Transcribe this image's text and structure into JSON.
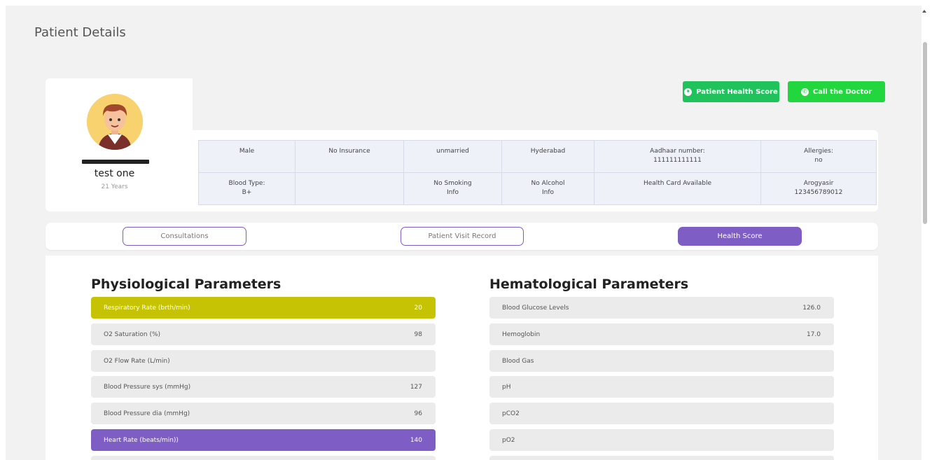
{
  "page": {
    "title": "Patient Details"
  },
  "patient": {
    "name": "test one",
    "age": "21 Years"
  },
  "actions": {
    "health_score_label": "Patient Health Score",
    "call_doctor_label": "Call the Doctor"
  },
  "info": {
    "gender": "Male",
    "insurance": "No Insurance",
    "marital": "unmarried",
    "city": "Hyderabad",
    "aadhaar_label": "Aadhaar number:",
    "aadhaar_value": "111111111111",
    "allergies_label": "Allergies:",
    "allergies_value": "no",
    "blood_type_label": "Blood Type:",
    "blood_type_value": "B+",
    "smoking_1": "No Smoking",
    "smoking_2": "Info",
    "alcohol_1": "No Alcohol",
    "alcohol_2": "Info",
    "health_card": "Health Card Available",
    "arogya_label": "Arogyasir",
    "arogya_value": "123456789012"
  },
  "tabs": {
    "consultations": "Consultations",
    "visit_record": "Patient Visit Record",
    "health_score": "Health Score"
  },
  "physiological": {
    "title": "Physiological Parameters",
    "rows": [
      {
        "label": "Respiratory Rate (brth/min)",
        "value": "20"
      },
      {
        "label": "O2 Saturation (%)",
        "value": "98"
      },
      {
        "label": "O2 Flow Rate (L/min)",
        "value": ""
      },
      {
        "label": "Blood Pressure sys (mmHg)",
        "value": "127"
      },
      {
        "label": "Blood Pressure dia (mmHg)",
        "value": "96"
      },
      {
        "label": "Heart Rate (beats/min))",
        "value": "140"
      }
    ]
  },
  "hematological": {
    "title": "Hematological Parameters",
    "rows": [
      {
        "label": "Blood Glucose Levels",
        "value": "126.0"
      },
      {
        "label": "Hemoglobin",
        "value": "17.0"
      },
      {
        "label": "Blood Gas",
        "value": ""
      },
      {
        "label": "pH",
        "value": ""
      },
      {
        "label": "pCO2",
        "value": ""
      },
      {
        "label": "pO2",
        "value": ""
      }
    ]
  },
  "colors": {
    "highlight_yellow": "#c5c304",
    "highlight_purple": "#7e5dc4",
    "green_button": "#20c25c"
  }
}
